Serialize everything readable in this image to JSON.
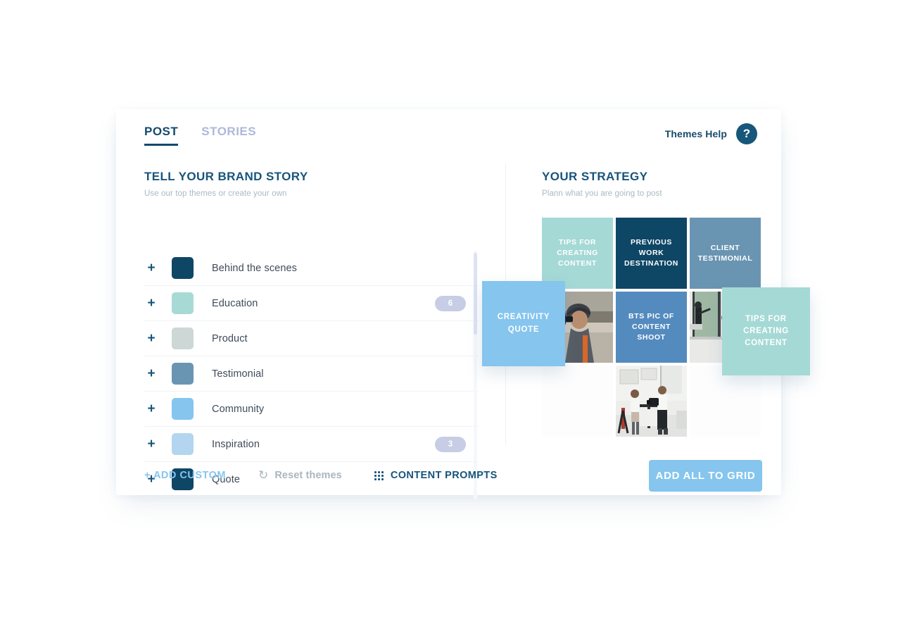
{
  "topbar": {
    "tabs": [
      {
        "label": "POST",
        "active": true
      },
      {
        "label": "STORIES",
        "active": false
      }
    ],
    "help_label": "Themes Help",
    "help_icon": "question-mark-icon",
    "help_glyph": "?"
  },
  "left": {
    "title": "TELL YOUR BRAND STORY",
    "subtitle": "Use our top themes or create your own",
    "themes": [
      {
        "label": "Behind the scenes",
        "color": "#0E4666",
        "count": ""
      },
      {
        "label": "Education",
        "color": "#A8DAD5",
        "count": "6"
      },
      {
        "label": "Product",
        "color": "#CDD8D6",
        "count": ""
      },
      {
        "label": "Testimonial",
        "color": "#6A95B2",
        "count": ""
      },
      {
        "label": "Community",
        "color": "#85C5EE",
        "count": ""
      },
      {
        "label": "Inspiration",
        "color": "#B3D5EF",
        "count": "3"
      },
      {
        "label": "Quote",
        "color": "#0E4666",
        "count": ""
      }
    ],
    "actions": {
      "add_custom": "+ ADD CUSTOM",
      "reset": "Reset themes",
      "reset_icon": "refresh-icon",
      "reset_glyph": "↻",
      "prompts": "CONTENT PROMPTS",
      "prompts_icon": "grid-dots-icon"
    }
  },
  "right": {
    "title": "YOUR STRATEGY",
    "subtitle": "Plann what you are going to post",
    "grid": [
      {
        "type": "text",
        "text": "TIPS FOR CREATING CONTENT",
        "color": "#A5D9D5"
      },
      {
        "type": "text",
        "text": "PREVIOUS WORK DESTINATION",
        "color": "#0E4666"
      },
      {
        "type": "text",
        "text": "CLIENT TESTIMONIAL",
        "color": "#6A95B2"
      },
      {
        "type": "photo",
        "text": "",
        "color": "#C9C4BC",
        "photo": "videographer-outdoors-photo"
      },
      {
        "type": "text",
        "text": "BTS PIC OF CONTENT SHOOT",
        "color": "#548BBF"
      },
      {
        "type": "photo",
        "text": "",
        "color": "#D3D8D6",
        "photo": "studio-crew-window-photo"
      },
      {
        "type": "empty",
        "text": "",
        "color": "#FDFDFE"
      },
      {
        "type": "photo",
        "text": "",
        "color": "#D8DAD9",
        "photo": "studio-shoot-two-people-photo"
      },
      {
        "type": "empty",
        "text": "",
        "color": "#FDFDFE"
      }
    ],
    "floating": [
      {
        "id": "creativity",
        "text": "CREATIVITY QUOTE",
        "color": "#85C5EE"
      },
      {
        "id": "tips",
        "text": "TIPS FOR CREATING CONTENT",
        "color": "#A5D9D5"
      }
    ],
    "add_all_label": "ADD ALL TO GRID"
  },
  "colors": {
    "navy": "#16537A",
    "sky": "#85C5EE",
    "badge": "#C6CDE5",
    "muted": "#AAB6C0"
  }
}
